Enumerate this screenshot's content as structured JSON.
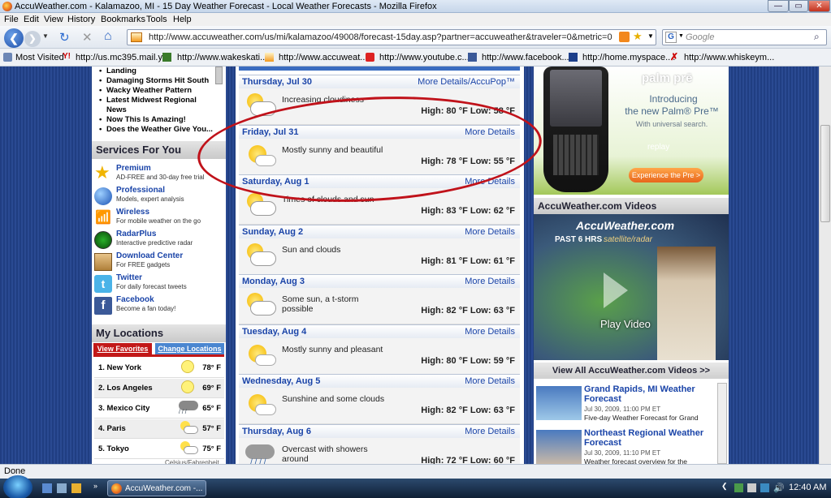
{
  "window": {
    "title": "AccuWeather.com - Kalamazoo, MI - 15 Day Weather Forecast - Local Weather Forecasts - Mozilla Firefox",
    "minimize": "—",
    "maximize": "▭",
    "close": "✕"
  },
  "menu": [
    "File",
    "Edit",
    "View",
    "History",
    "Bookmarks",
    "Tools",
    "Help"
  ],
  "nav": {
    "url": "http://www.accuweather.com/us/mi/kalamazoo/49008/forecast-15day.asp?partner=accuweather&traveler=0&metric=0",
    "search_placeholder": "Google"
  },
  "bookmarks": [
    {
      "label": "Most Visited",
      "icon": "bookmark-star-icon"
    },
    {
      "label": "http://us.mc395.mail.y...",
      "icon": "yahoo-icon"
    },
    {
      "label": "http://www.wakeskati...",
      "icon": "wake-icon"
    },
    {
      "label": "http://www.accuweat...",
      "icon": "accuweather-icon"
    },
    {
      "label": "http://www.youtube.c...",
      "icon": "youtube-icon"
    },
    {
      "label": "http://www.facebook...",
      "icon": "facebook-icon"
    },
    {
      "label": "http://home.myspace....",
      "icon": "myspace-icon"
    },
    {
      "label": "http://www.whiskeym...",
      "icon": "whiskey-icon"
    }
  ],
  "news": [
    "Landing",
    "Damaging Storms Hit South",
    "Wacky Weather Pattern",
    "Latest Midwest Regional News",
    "Now This Is Amazing!",
    "Does the Weather Give You..."
  ],
  "services": {
    "title": "Services For You",
    "items": [
      {
        "name": "Premium",
        "desc": "AD-FREE and 30-day free trial",
        "icon": "premium-star-icon"
      },
      {
        "name": "Professional",
        "desc": "Models, expert analysis",
        "icon": "globe-icon"
      },
      {
        "name": "Wireless",
        "desc": "For mobile weather on the go",
        "icon": "wireless-icon"
      },
      {
        "name": "RadarPlus",
        "desc": "Interactive predictive radar",
        "icon": "radar-icon"
      },
      {
        "name": "Download Center",
        "desc": "For FREE gadgets",
        "icon": "download-box-icon"
      },
      {
        "name": "Twitter",
        "desc": "For daily forecast tweets",
        "icon": "twitter-icon"
      },
      {
        "name": "Facebook",
        "desc": "Become a fan today!",
        "icon": "facebook-icon"
      }
    ]
  },
  "locations": {
    "title": "My Locations",
    "tab_favorites": "View Favorites",
    "tab_change": "Change Locations",
    "items": [
      {
        "name": "1.  New York",
        "temp": "78° F",
        "weather": "sunny"
      },
      {
        "name": "2.  Los Angeles",
        "temp": "69° F",
        "weather": "sunny"
      },
      {
        "name": "3.  Mexico City",
        "temp": "65° F",
        "weather": "rain"
      },
      {
        "name": "4.  Paris",
        "temp": "57° F",
        "weather": "partly"
      },
      {
        "name": "5.  Tokyo",
        "temp": "75° F",
        "weather": "partly"
      }
    ],
    "footer": "Celsius/Fahrenheit"
  },
  "forecast": [
    {
      "day": "Thursday, Jul 30",
      "link": "More Details/AccuPop™",
      "cond": "Increasing cloudiness",
      "hl": "High: 80 °F  Low: 58 °F",
      "icon": "partly"
    },
    {
      "day": "Friday, Jul 31",
      "link": "More Details",
      "cond": "Mostly sunny and beautiful",
      "hl": "High: 78 °F  Low: 55 °F",
      "icon": "sunny"
    },
    {
      "day": "Saturday, Aug 1",
      "link": "More Details",
      "cond": "Times of clouds and sun",
      "hl": "High: 83 °F  Low: 62 °F",
      "icon": "partly"
    },
    {
      "day": "Sunday, Aug 2",
      "link": "More Details",
      "cond": "Sun and clouds",
      "hl": "High: 81 °F  Low: 61 °F",
      "icon": "partly"
    },
    {
      "day": "Monday, Aug 3",
      "link": "More Details",
      "cond": "Some sun, a t-storm possible",
      "hl": "High: 82 °F  Low: 63 °F",
      "icon": "partly"
    },
    {
      "day": "Tuesday, Aug 4",
      "link": "More Details",
      "cond": "Mostly sunny and pleasant",
      "hl": "High: 80 °F  Low: 59 °F",
      "icon": "sunny"
    },
    {
      "day": "Wednesday, Aug 5",
      "link": "More Details",
      "cond": "Sunshine and some clouds",
      "hl": "High: 82 °F  Low: 63 °F",
      "icon": "sunny"
    },
    {
      "day": "Thursday, Aug 6",
      "link": "More Details",
      "cond": "Overcast with showers around",
      "hl": "High: 72 °F  Low: 60 °F",
      "icon": "rain"
    }
  ],
  "ad": {
    "brand": "palm prē",
    "headline1": "Introducing",
    "headline2": "the new Palm® Pre™",
    "sub": "With universal search.",
    "replay": "replay",
    "cta": "Experience the Pre >"
  },
  "videos": {
    "title": "AccuWeather.com Videos",
    "logo": "AccuWeather.com",
    "banner": "PAST 6 HRS",
    "banner2": "satellite/radar",
    "play": "Play Video",
    "view_all": "View All AccuWeather.com Videos >>",
    "items": [
      {
        "title": "Grand Rapids, MI Weather Forecast",
        "date": "Jul 30, 2009, 11:00 PM ET",
        "desc": "Five-day Weather Forecast for Grand"
      },
      {
        "title": "Northeast Regional Weather Forecast",
        "date": "Jul 30, 2009, 11:10 PM ET",
        "desc": "Weather forecast overview for the"
      }
    ]
  },
  "status": "Done",
  "taskbar": {
    "app": "AccuWeather.com -...",
    "time": "12:40 AM"
  }
}
